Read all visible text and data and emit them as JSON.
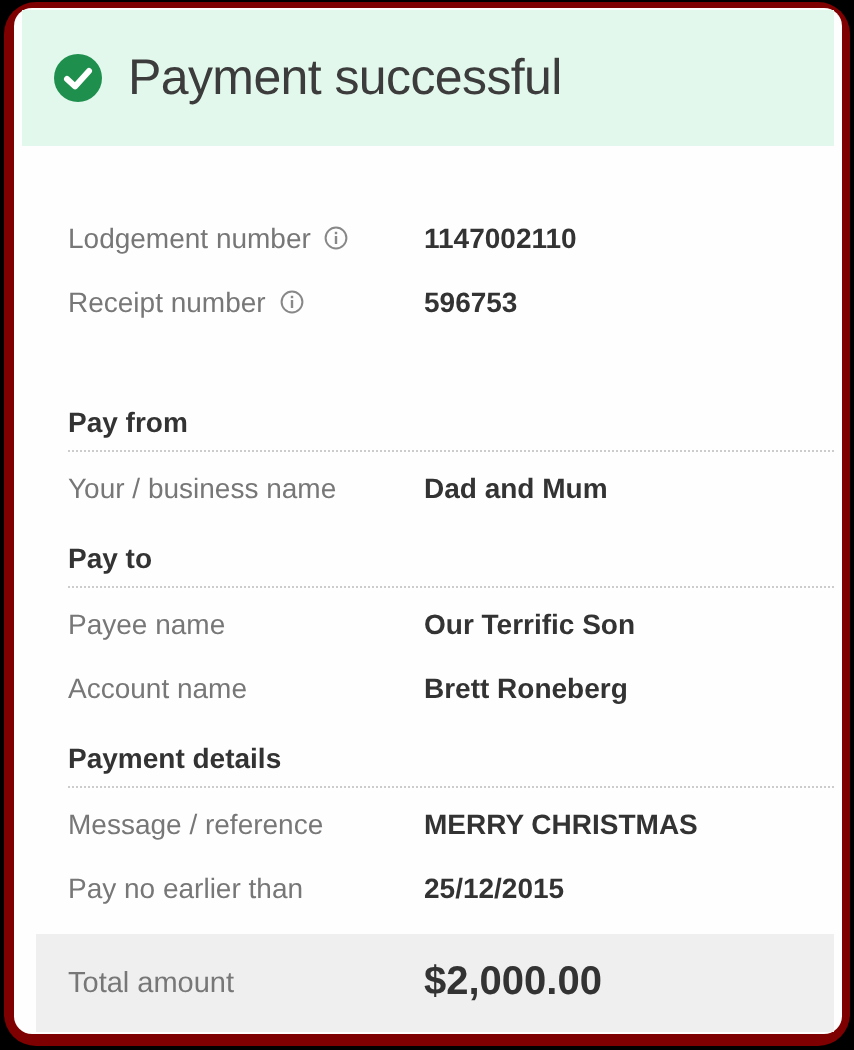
{
  "header": {
    "title": "Payment successful"
  },
  "references": [
    {
      "label": "Lodgement number",
      "info": true,
      "value": "1147002110"
    },
    {
      "label": "Receipt number",
      "info": true,
      "value": "596753"
    }
  ],
  "sections": [
    {
      "heading": "Pay from",
      "rows": [
        {
          "label": "Your / business name",
          "value": "Dad and Mum"
        }
      ]
    },
    {
      "heading": "Pay to",
      "rows": [
        {
          "label": "Payee name",
          "value": "Our Terrific Son"
        },
        {
          "label": "Account name",
          "value": "Brett Roneberg"
        }
      ]
    },
    {
      "heading": "Payment details",
      "rows": [
        {
          "label": "Message / reference",
          "value": "MERRY CHRISTMAS"
        },
        {
          "label": "Pay no earlier than",
          "value": "25/12/2015"
        }
      ]
    }
  ],
  "total": {
    "label": "Total amount",
    "value": "$2,000.00"
  }
}
